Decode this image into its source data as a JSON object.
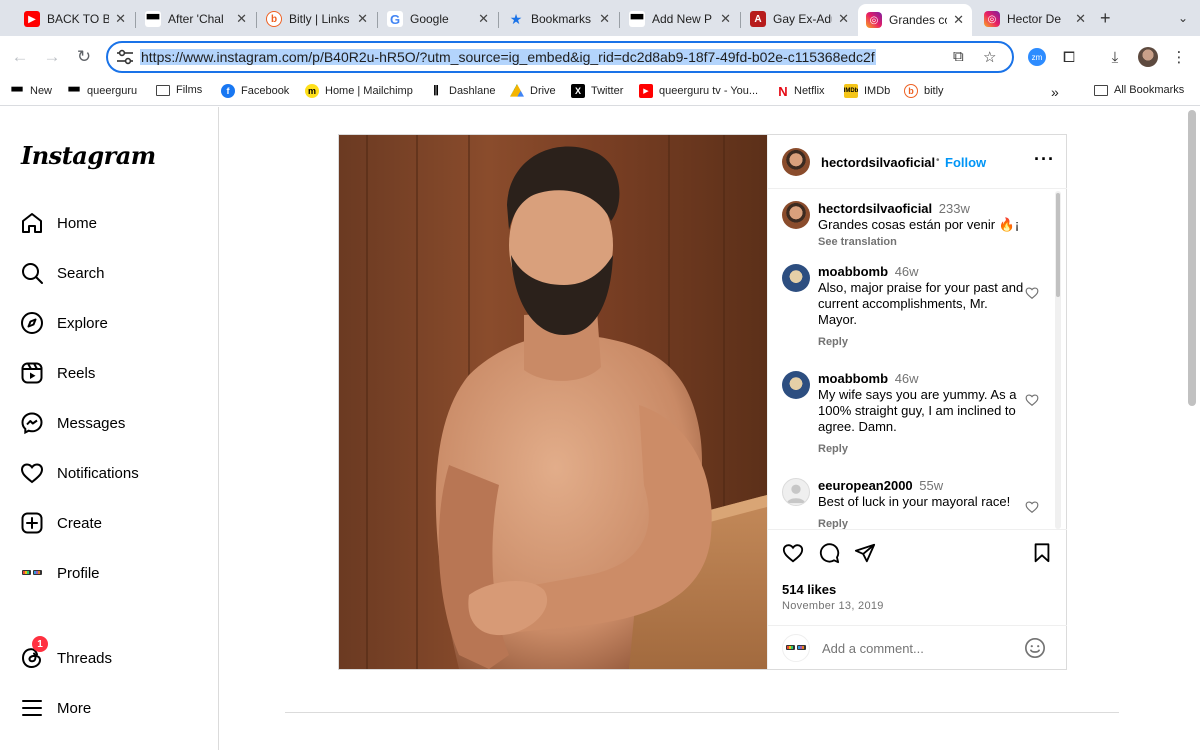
{
  "browser": {
    "tabs": [
      {
        "title": "BACK TO B",
        "favicon": "youtube-icon"
      },
      {
        "title": "After 'Chal",
        "favicon": "sunglasses-icon"
      },
      {
        "title": "Bitly | Links",
        "favicon": "bitly-icon"
      },
      {
        "title": "Google",
        "favicon": "google-icon"
      },
      {
        "title": "Bookmarks",
        "favicon": "star-icon"
      },
      {
        "title": "Add New P",
        "favicon": "sunglasses-icon"
      },
      {
        "title": "Gay Ex-Adu",
        "favicon": "a-icon"
      },
      {
        "title": "Grandes co",
        "favicon": "instagram-icon"
      },
      {
        "title": "Hector De",
        "favicon": "instagram-icon"
      }
    ],
    "active_tab_index": 7,
    "url": "https://www.instagram.com/p/B40R2u-hR5O/?utm_source=ig_embed&ig_rid=dc2d8ab9-18f7-49fd-b02e-c115368edc2f",
    "bookmarks": [
      {
        "label": "New",
        "icon": "sunglasses-icon"
      },
      {
        "label": "queerguru",
        "icon": "sunglasses-icon"
      },
      {
        "label": "Films",
        "icon": "folder-icon"
      },
      {
        "label": "Facebook",
        "icon": "facebook-icon"
      },
      {
        "label": "Home | Mailchimp",
        "icon": "mailchimp-icon"
      },
      {
        "label": "Dashlane",
        "icon": "dashlane-icon"
      },
      {
        "label": "Drive",
        "icon": "drive-icon"
      },
      {
        "label": "Twitter",
        "icon": "x-icon"
      },
      {
        "label": "queerguru tv - You...",
        "icon": "youtube-icon"
      },
      {
        "label": "Netflix",
        "icon": "netflix-icon"
      },
      {
        "label": "IMDb",
        "icon": "imdb-icon"
      },
      {
        "label": "bitly",
        "icon": "bitly-icon"
      }
    ],
    "all_bookmarks": "All Bookmarks",
    "extension_badge": "zm"
  },
  "instagram": {
    "logo": "Instagram",
    "nav": {
      "home": "Home",
      "search": "Search",
      "explore": "Explore",
      "reels": "Reels",
      "messages": "Messages",
      "notifications": "Notifications",
      "create": "Create",
      "profile": "Profile",
      "threads": "Threads",
      "threads_badge": "1",
      "more": "More"
    },
    "post": {
      "author": "hectordsilvaoficial",
      "follow": "Follow",
      "separator": "•",
      "caption": {
        "user": "hectordsilvaoficial",
        "age": "233w",
        "text": "Grandes cosas están por venir 🔥¡",
        "see_translation": "See translation"
      },
      "comments": [
        {
          "user": "moabbomb",
          "age": "46w",
          "text": "Also, major praise for your past and current accomplishments, Mr. Mayor.",
          "reply": "Reply"
        },
        {
          "user": "moabbomb",
          "age": "46w",
          "text": "My wife says you are yummy. As a 100% straight guy, I am inclined to agree. Damn.",
          "reply": "Reply"
        },
        {
          "user": "eeuropean2000",
          "age": "55w",
          "text": "Best of luck in your mayoral race!",
          "reply": "Reply"
        }
      ],
      "likes": "514 likes",
      "date": "November 13, 2019",
      "add_comment_placeholder": "Add a comment..."
    }
  },
  "colors": {
    "accent_blue": "#1a73e8",
    "instagram_link": "#0095f6",
    "badge_red": "#ff3040"
  }
}
